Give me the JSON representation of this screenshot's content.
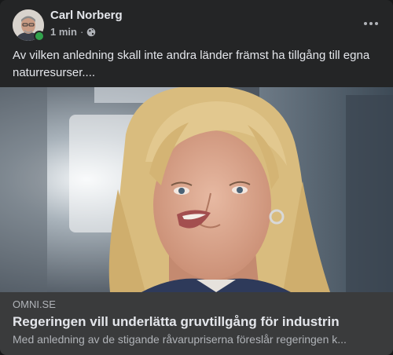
{
  "post": {
    "author": "Carl Norberg",
    "time": "1 min",
    "separator": "·",
    "audience_icon": "globe-icon",
    "text": "Av vilken anledning skall inte andra länder främst ha tillgång till egna naturresurser...."
  },
  "link": {
    "domain": "OMNI.SE",
    "title": "Regeringen vill underlätta gruvtillgång för industrin",
    "description": "Med anledning av de stigande råvarupriserna föreslår regeringen k..."
  },
  "colors": {
    "card_background": "#242526",
    "link_background": "#3a3b3c",
    "primary_text": "#e4e6eb",
    "secondary_text": "#b0b3b8",
    "online_indicator": "#31a24c"
  }
}
